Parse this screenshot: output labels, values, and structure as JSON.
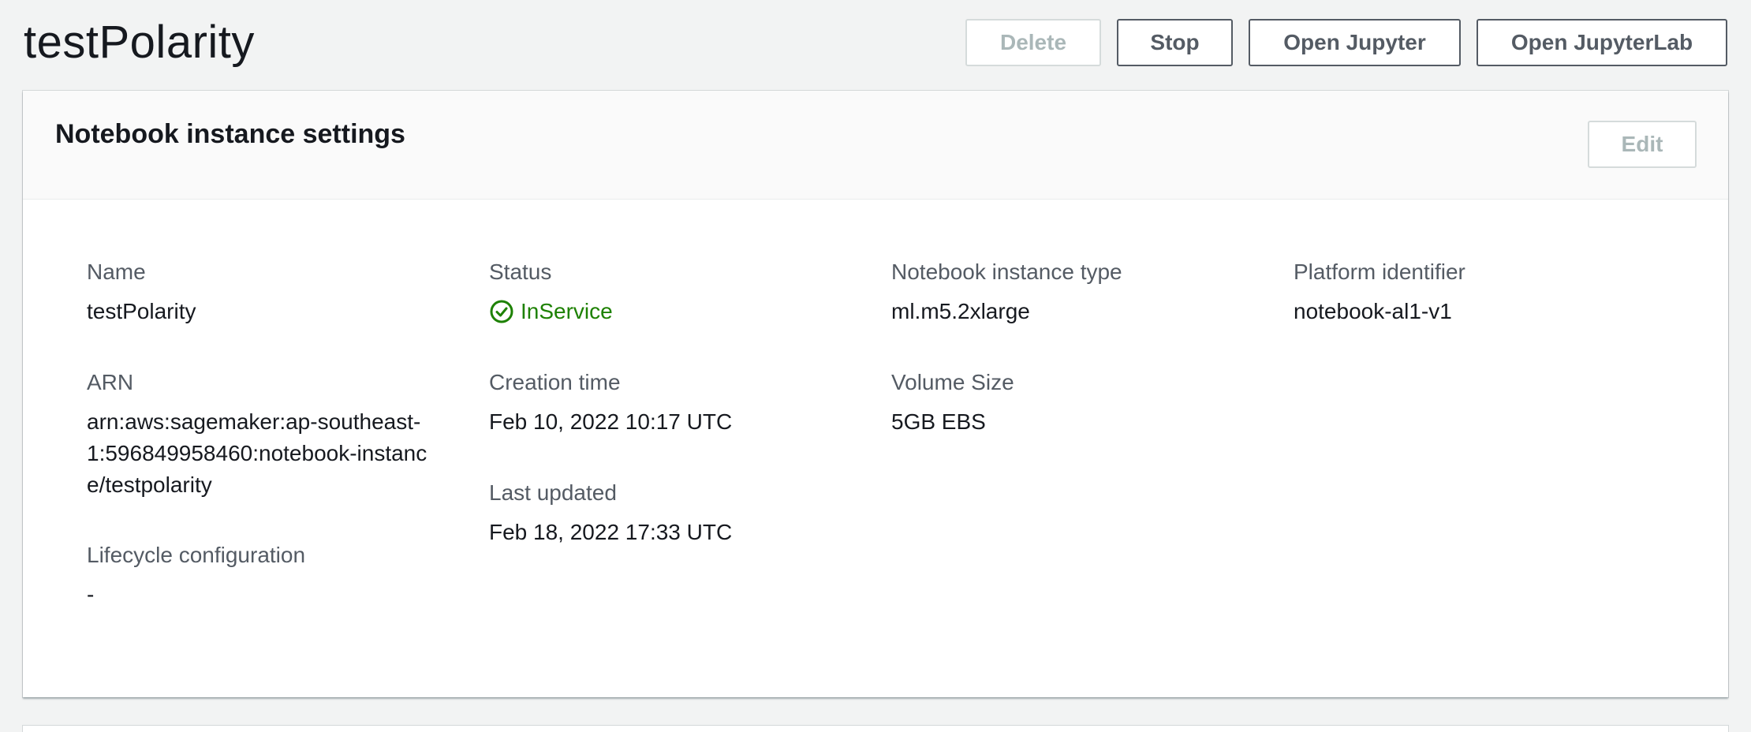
{
  "header": {
    "title": "testPolarity",
    "buttons": {
      "delete": "Delete",
      "stop": "Stop",
      "open_jupyter": "Open Jupyter",
      "open_jupyterlab": "Open JupyterLab"
    }
  },
  "panel": {
    "title": "Notebook instance settings",
    "edit_label": "Edit",
    "fields": {
      "name": {
        "label": "Name",
        "value": "testPolarity"
      },
      "arn": {
        "label": "ARN",
        "value": "arn:aws:sagemaker:ap-southeast-1:596849958460:notebook-instance/testpolarity"
      },
      "lifecycle": {
        "label": "Lifecycle configuration",
        "value": "-"
      },
      "status": {
        "label": "Status",
        "value": "InService",
        "icon": "check-circle-icon",
        "color": "#1d8102"
      },
      "creation_time": {
        "label": "Creation time",
        "value": "Feb 10, 2022 10:17 UTC"
      },
      "last_updated": {
        "label": "Last updated",
        "value": "Feb 18, 2022 17:33 UTC"
      },
      "instance_type": {
        "label": "Notebook instance type",
        "value": "ml.m5.2xlarge"
      },
      "volume_size": {
        "label": "Volume Size",
        "value": "5GB EBS"
      },
      "platform": {
        "label": "Platform identifier",
        "value": "notebook-al1-v1"
      }
    }
  },
  "colors": {
    "background": "#f2f3f3",
    "text": "#16191f",
    "label": "#545b64",
    "success": "#1d8102",
    "disabled": "#aab7b8"
  }
}
